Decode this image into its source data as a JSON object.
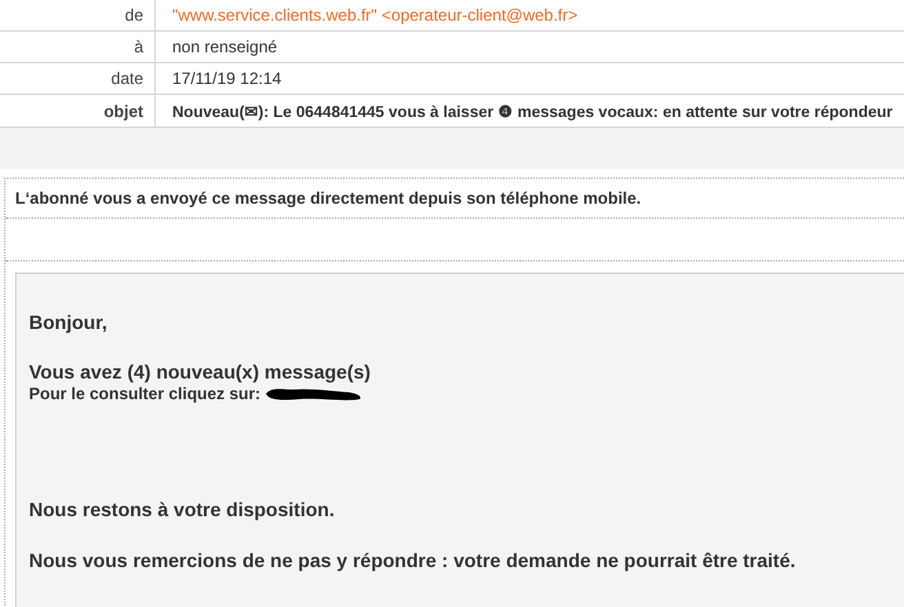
{
  "headers": [
    {
      "label": "de",
      "value": "\"www.service.clients.web.fr\" <operateur-client@web.fr>",
      "kind": "sender"
    },
    {
      "label": "à",
      "value": "non renseigné",
      "kind": "plain"
    },
    {
      "label": "date",
      "value": "17/11/19 12:14",
      "kind": "plain"
    },
    {
      "label": "objet",
      "value": "Nouveau(✉): Le 0644841445 vous à laisser ❹ messages vocaux: en attente sur votre répondeur",
      "kind": "subject"
    }
  ],
  "notice": "L‘abonné vous a envoyé ce message directement depuis son téléphone mobile.",
  "body": {
    "greeting": "Bonjour,",
    "headline": "Vous avez (4) nouveau(x) message(s)",
    "link_prompt": "Pour le consulter cliquez sur:",
    "closing": "Nous restons à votre disposition.",
    "footer": "Nous vous remercions de ne pas y répondre : votre demande ne pourrait être traité."
  }
}
